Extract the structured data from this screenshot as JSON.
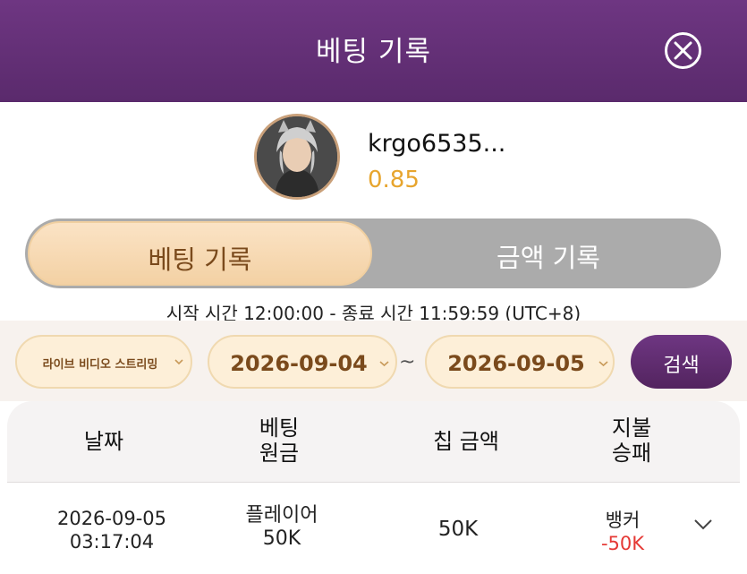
{
  "header": {
    "title": "베팅 기록"
  },
  "profile": {
    "username": "krgo6535...",
    "balance": "0.85"
  },
  "tabs": [
    {
      "label": "베팅 기록",
      "active": true
    },
    {
      "label": "금액 기록",
      "active": false
    }
  ],
  "time_range": "시작 시간 12:00:00 - 종료 시간 11:59:59 (UTC+8)",
  "filters": {
    "game_type": "라이브 비디오 스트리밍",
    "date_from": "2026-09-04",
    "separator": "~",
    "date_to": "2026-09-05",
    "search_label": "검색"
  },
  "table": {
    "headers": {
      "date": "날짜",
      "bet_line1": "베팅",
      "bet_line2": "원금",
      "chip": "칩 금액",
      "pay_line1": "지불",
      "pay_line2": "승패"
    },
    "rows": [
      {
        "date": "2026-09-05",
        "time": "03:17:04",
        "bet_side": "플레이어",
        "bet_amount": "50K",
        "chip_amount": "50K",
        "result_side": "뱅커",
        "win_loss": "-50K"
      }
    ]
  },
  "colors": {
    "header_bg": "#6e3682",
    "accent_gold": "#e7a52e",
    "loss_red": "#e53935",
    "tab_active_bg": "#f3d1a4"
  }
}
